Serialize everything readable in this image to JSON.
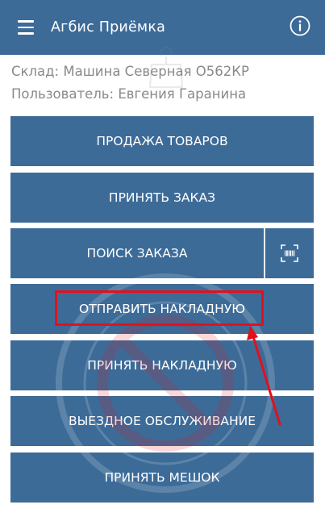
{
  "app_bar": {
    "title": "Агбис Приёмка",
    "menu_icon": "hamburger-menu-icon",
    "info_icon": "info-circle-icon",
    "color": "#3d6b98"
  },
  "info": {
    "warehouse": "Склад: Машина Северная О562КР",
    "user": "Пользователь: Евгения Гаранина"
  },
  "buttons": {
    "sell_goods": "ПРОДАЖА ТОВАРОВ",
    "accept_order": "ПРИНЯТЬ ЗАКАЗ",
    "search_order": "ПОИСК ЗАКАЗА",
    "send_invoice": "ОТПРАВИТЬ НАКЛАДНУЮ",
    "accept_invoice": "ПРИНЯТЬ НАКЛАДНУЮ",
    "field_service": "ВЫЕЗДНОЕ ОБСЛУЖИВАНИЕ",
    "accept_bag": "ПРИНЯТЬ МЕШОК"
  },
  "icons": {
    "scan": "barcode-scan-icon"
  },
  "annotation": {
    "highlight_color": "#e3101b"
  }
}
